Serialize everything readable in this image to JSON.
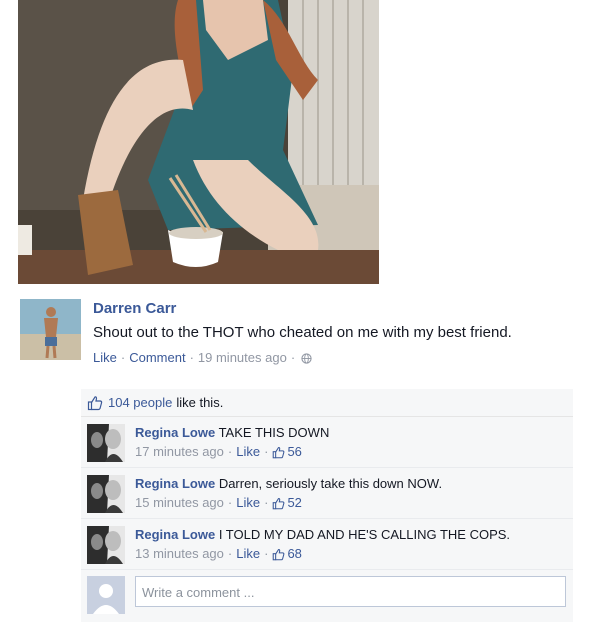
{
  "post": {
    "author": "Darren Carr",
    "text": "Shout out to the THOT who cheated on me with my best friend.",
    "like_link": "Like",
    "comment_link": "Comment",
    "timestamp": "19 minutes ago"
  },
  "likes": {
    "count": "104 people",
    "suffix": "like this."
  },
  "comments": [
    {
      "author": "Regina Lowe",
      "text": "TAKE THIS DOWN",
      "timestamp": "17 minutes ago",
      "like_link": "Like",
      "like_count": "56"
    },
    {
      "author": "Regina Lowe",
      "text": "Darren, seriously take this down NOW.",
      "timestamp": "15 minutes ago",
      "like_link": "Like",
      "like_count": "52"
    },
    {
      "author": "Regina Lowe",
      "text": "I TOLD MY DAD AND HE'S CALLING THE COPS.",
      "timestamp": "13 minutes ago",
      "like_link": "Like",
      "like_count": "68"
    }
  ],
  "composer": {
    "placeholder": "Write a comment ..."
  },
  "colors": {
    "link": "#3b5998",
    "meta": "#9197a3",
    "ufi_bg": "#f6f7f8"
  },
  "icons": [
    "globe-icon",
    "thumbs-up-icon",
    "default-avatar-icon"
  ]
}
